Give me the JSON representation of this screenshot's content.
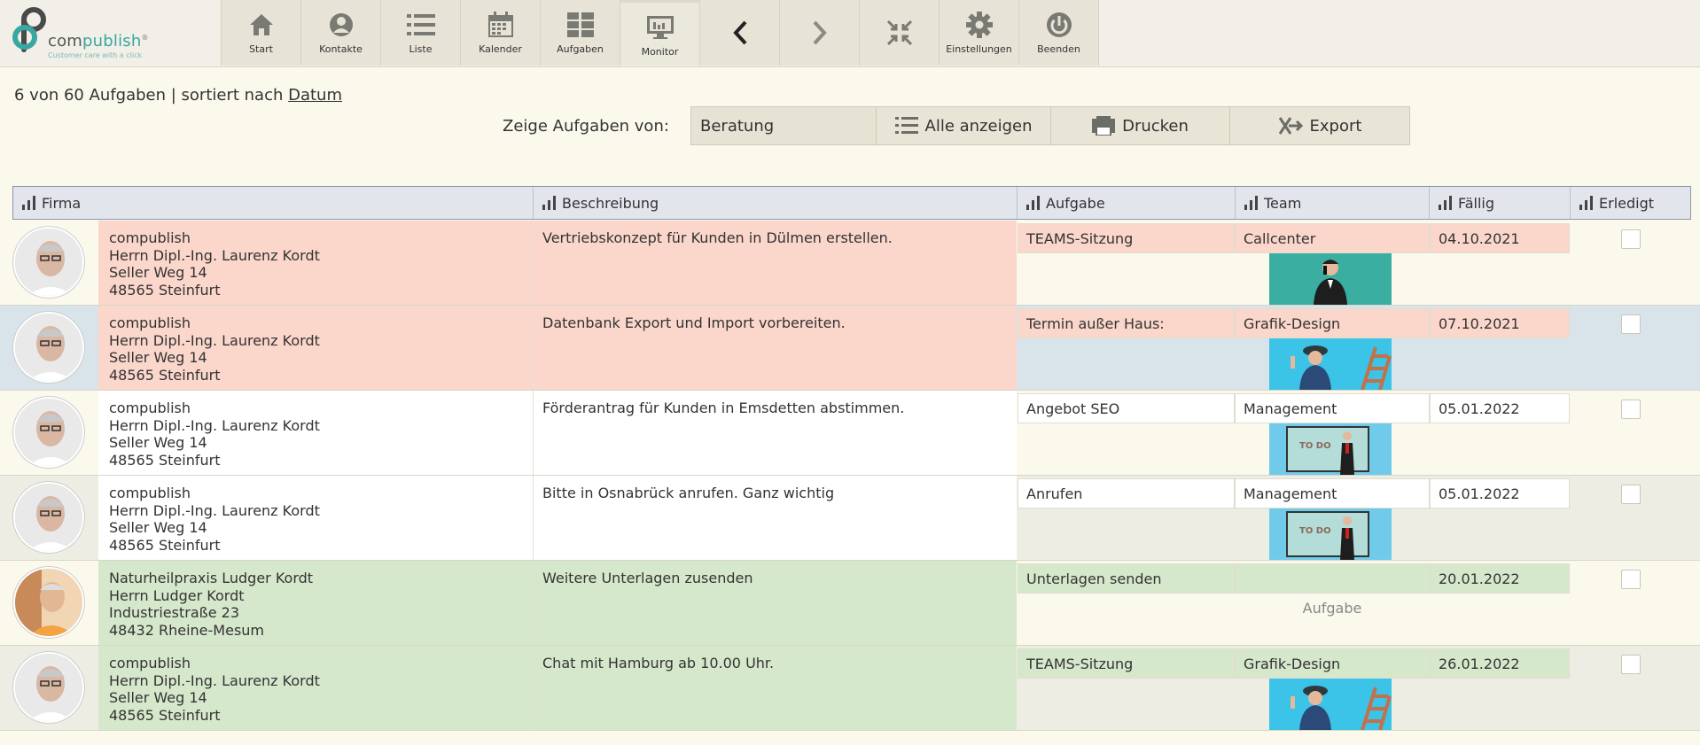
{
  "logo": {
    "word_a": "com",
    "word_b": "publish",
    "reg": "®",
    "tagline": "Customer care with a click"
  },
  "toolbar": [
    {
      "label": "Start",
      "icon": "home-icon"
    },
    {
      "label": "Kontakte",
      "icon": "contacts-icon"
    },
    {
      "label": "Liste",
      "icon": "list-icon"
    },
    {
      "label": "Kalender",
      "icon": "calendar-icon"
    },
    {
      "label": "Aufgaben",
      "icon": "tasks-icon"
    },
    {
      "label": "Monitor",
      "icon": "monitor-icon"
    },
    {
      "label": "",
      "icon": "chevron-left-icon"
    },
    {
      "label": "",
      "icon": "chevron-right-icon"
    },
    {
      "label": "",
      "icon": "collapse-icon"
    },
    {
      "label": "Einstellungen",
      "icon": "gear-icon"
    },
    {
      "label": "Beenden",
      "icon": "power-icon"
    }
  ],
  "summary": {
    "prefix": "6 von 60 Aufgaben | sortiert nach ",
    "sort_link": "Datum"
  },
  "filter": {
    "label": "Zeige Aufgaben von:",
    "selected": "Beratung",
    "show_all": "Alle anzeigen",
    "print": "Drucken",
    "export": "Export"
  },
  "columns": {
    "firma": "Firma",
    "beschreibung": "Beschreibung",
    "aufgabe": "Aufgabe",
    "team": "Team",
    "faellig": "Fällig",
    "erledigt": "Erledigt"
  },
  "colors": {
    "overdue": "#fbd6cb",
    "upcoming": "#d6e8cb",
    "header_border": "#8a97ad",
    "accent_teal": "#3aa6a1"
  },
  "rows": [
    {
      "firma": [
        "compublish",
        "Herrn Dipl.-Ing. Laurenz Kordt",
        "Seller Weg 14",
        "48565 Steinfurt"
      ],
      "beschreibung": "Vertriebskonzept für Kunden in Dülmen erstellen.",
      "aufgabe": "TEAMS-Sitzung",
      "team": "Callcenter",
      "faellig": "04.10.2021",
      "erledigt": false,
      "status": "overdue",
      "team_image": "callcenter"
    },
    {
      "firma": [
        "compublish",
        "Herrn Dipl.-Ing. Laurenz Kordt",
        "Seller Weg 14",
        "48565 Steinfurt"
      ],
      "beschreibung": "Datenbank Export und Import vorbereiten.",
      "aufgabe": "Termin außer Haus:",
      "team": "Grafik-Design",
      "faellig": "07.10.2021",
      "erledigt": false,
      "status": "overdue",
      "team_image": "grafik"
    },
    {
      "firma": [
        "compublish",
        "Herrn Dipl.-Ing. Laurenz Kordt",
        "Seller Weg 14",
        "48565 Steinfurt"
      ],
      "beschreibung": "Förderantrag für Kunden in Emsdetten abstimmen.",
      "aufgabe": "Angebot SEO",
      "team": "Management",
      "faellig": "05.01.2022",
      "erledigt": false,
      "status": "normal",
      "team_image": "management",
      "todo_text": "TO DO"
    },
    {
      "firma": [
        "compublish",
        "Herrn Dipl.-Ing. Laurenz Kordt",
        "Seller Weg 14",
        "48565 Steinfurt"
      ],
      "beschreibung": "Bitte in Osnabrück anrufen. Ganz wichtig",
      "aufgabe": "Anrufen",
      "team": "Management",
      "faellig": "05.01.2022",
      "erledigt": false,
      "status": "normal",
      "team_image": "management",
      "todo_text": "TO DO"
    },
    {
      "firma": [
        "Naturheilpraxis Ludger Kordt",
        "Herrn Ludger Kordt",
        "Industriestraße 23",
        "48432 Rheine-Mesum"
      ],
      "beschreibung": "Weitere Unterlagen zusenden",
      "aufgabe": "Unterlagen senden",
      "team": "",
      "faellig": "20.01.2022",
      "erledigt": false,
      "status": "upcoming",
      "team_placeholder": "Aufgabe"
    },
    {
      "firma": [
        "compublish",
        "Herrn Dipl.-Ing. Laurenz Kordt",
        "Seller Weg 14",
        "48565 Steinfurt"
      ],
      "beschreibung": "Chat mit Hamburg ab 10.00 Uhr.",
      "aufgabe": "TEAMS-Sitzung",
      "team": "Grafik-Design",
      "faellig": "26.01.2022",
      "erledigt": false,
      "status": "upcoming",
      "team_image": "grafik"
    }
  ]
}
